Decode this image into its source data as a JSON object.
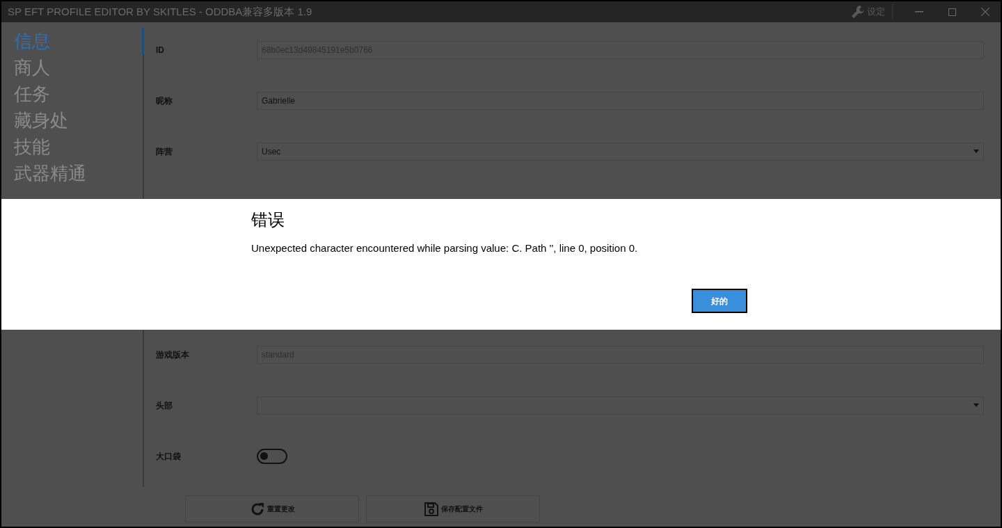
{
  "window": {
    "title": "SP EFT PROFILE EDITOR BY SKITLES - ODDBA兼容多版本 1.9",
    "settings_label": "设定"
  },
  "sidebar": {
    "items": [
      {
        "label": "信息",
        "selected": true
      },
      {
        "label": "商人",
        "selected": false
      },
      {
        "label": "任务",
        "selected": false
      },
      {
        "label": "藏身处",
        "selected": false
      },
      {
        "label": "技能",
        "selected": false
      },
      {
        "label": "武器精通",
        "selected": false
      }
    ]
  },
  "form_top": [
    {
      "kind": "text",
      "label": "ID",
      "value": "68b0ec13d49845191e5b0766",
      "disabled": true
    },
    {
      "kind": "text",
      "label": "昵称",
      "value": "Gabrielle",
      "disabled": false
    },
    {
      "kind": "select",
      "label": "阵营",
      "value": "Usec"
    }
  ],
  "form_bottom": [
    {
      "kind": "text",
      "label": "游戏版本",
      "value": "standard",
      "disabled": true
    },
    {
      "kind": "select",
      "label": "头部"
    },
    {
      "kind": "toggle",
      "label": "大口袋",
      "on": false
    }
  ],
  "buttons": [
    {
      "kind": "reset",
      "label": "重置更改"
    },
    {
      "kind": "save",
      "label": "保存配置文件"
    }
  ],
  "dialog": {
    "title": "错误",
    "message": "Unexpected character encountered while parsing value: C. Path '', line 0, position 0.",
    "button": "好的"
  }
}
